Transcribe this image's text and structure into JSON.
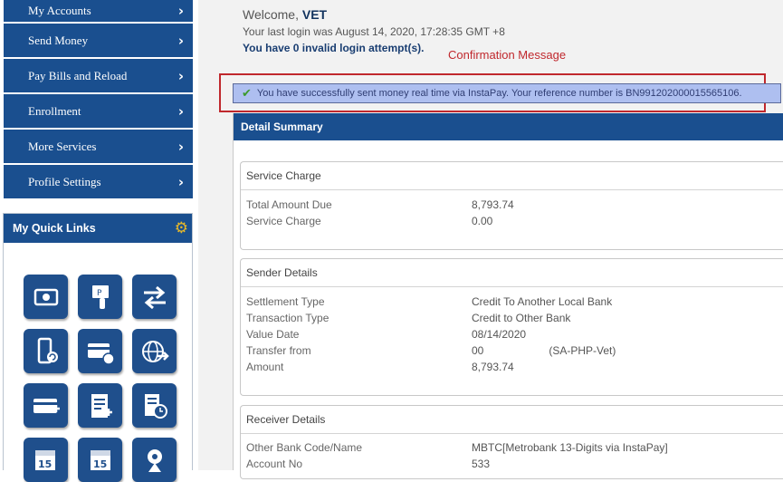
{
  "sidebar": {
    "items": [
      {
        "label": "My Accounts"
      },
      {
        "label": "Send Money"
      },
      {
        "label": "Pay Bills and Reload"
      },
      {
        "label": "Enrollment"
      },
      {
        "label": "More Services"
      },
      {
        "label": "Profile Settings"
      }
    ],
    "chevron": "›",
    "quick_links": {
      "title": "My Quick Links",
      "settings_icon": "gear-icon",
      "icons": [
        "bill-icon",
        "pay-touch-icon",
        "transfer-arrows-icon",
        "mobile-reload-icon",
        "card-reload-icon",
        "globe-transfer-icon",
        "card-payment-icon",
        "document-add-icon",
        "schedule-icon",
        "calendar-add-icon",
        "calendar-icon",
        "location-icon"
      ]
    }
  },
  "header": {
    "welcome_prefix": "Welcome,",
    "user_name": "VET",
    "last_login": "Your last login was August 14, 2020, 17:28:35 GMT +8",
    "invalid_attempts": "You have 0 invalid login attempt(s)."
  },
  "annotation": {
    "label": "Confirmation Message",
    "color": "#c0282d"
  },
  "confirmation": {
    "icon": "checkmark-icon",
    "message": "You have successfully sent money real time via InstaPay. Your reference number is BN991202000015565106."
  },
  "detail_summary": {
    "title": "Detail Summary",
    "service_charge": {
      "title": "Service Charge",
      "rows": [
        {
          "label": "Total Amount Due",
          "value": "8,793.74"
        },
        {
          "label": "Service Charge",
          "value": "0.00"
        }
      ]
    },
    "sender": {
      "title": "Sender Details",
      "rows": [
        {
          "label": "Settlement Type",
          "value": "Credit To Another Local Bank"
        },
        {
          "label": "Transaction Type",
          "value": "Credit to Other Bank"
        },
        {
          "label": "Value Date",
          "value": "08/14/2020"
        },
        {
          "label": "Transfer from",
          "value": "00",
          "value2": "(SA-PHP-Vet)"
        },
        {
          "label": "Amount",
          "value": "8,793.74"
        }
      ]
    },
    "receiver": {
      "title": "Receiver Details",
      "rows": [
        {
          "label": "Other Bank Code/Name",
          "value": "MBTC[Metrobank 13-Digits via InstaPay]"
        },
        {
          "label": "Account No",
          "value": "533"
        }
      ]
    }
  },
  "colors": {
    "brand_blue": "#1a4f8f",
    "confirm_bg": "#aebff0",
    "success_green": "#3c9a2c"
  }
}
